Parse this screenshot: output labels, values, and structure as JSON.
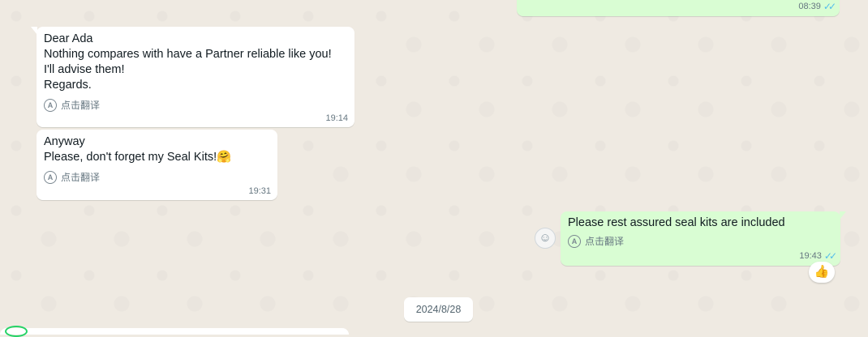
{
  "messages": [
    {
      "text": "",
      "time": "08:39",
      "direction": "out"
    },
    {
      "text": "Dear Ada\nNothing compares with have a Partner reliable like you!\nI'll advise them!\nRegards.",
      "translate_label": "点击翻译",
      "time": "19:14",
      "direction": "in"
    },
    {
      "text": "Anyway\nPlease, don't forget my Seal Kits!",
      "emoji": "🤗",
      "translate_label": "点击翻译",
      "time": "19:31",
      "direction": "in"
    },
    {
      "text": "Please rest assured seal kits are included",
      "translate_label": "点击翻译",
      "time": "19:43",
      "direction": "out",
      "reaction": "👍"
    }
  ],
  "date_divider": "2024/8/28",
  "icons": {
    "translate": "translate-icon",
    "read_receipt": "double-check-icon",
    "emoji_picker": "smiley-icon"
  },
  "colors": {
    "incoming": "#ffffff",
    "outgoing": "#d9fdd3",
    "background": "#efeae2",
    "read_tick": "#53bdeb"
  }
}
